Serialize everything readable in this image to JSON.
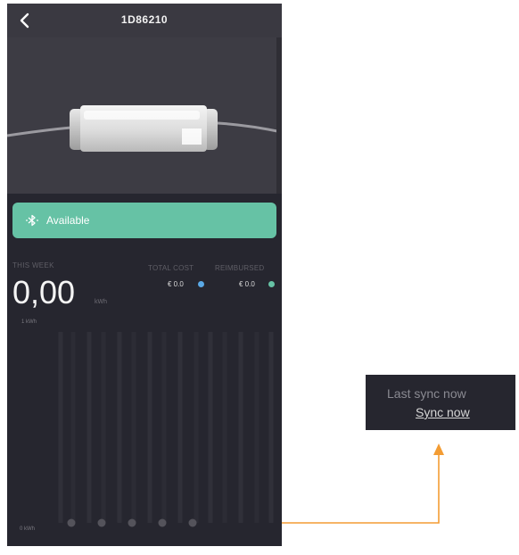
{
  "header": {
    "title": "1D86210",
    "back_icon": "chevron-left-icon"
  },
  "status": {
    "label": "Available",
    "icon": "bluetooth-icon",
    "color": "#66c2a5"
  },
  "summary": {
    "week_label": "THIS WEEK",
    "energy_value": "0,00",
    "energy_unit": "kWh",
    "total_cost_label": "TOTAL COST",
    "total_cost_value": "€ 0.0",
    "total_cost_color": "#5aa9e6",
    "reimbursed_label": "REIMBURSED",
    "reimbursed_value": "€ 0.0",
    "reimbursed_color": "#66c2a5"
  },
  "chart": {
    "axis_top_label": "1 kWh",
    "axis_bottom_label": "0 kWh"
  },
  "chart_data": {
    "type": "bar",
    "categories": [],
    "values": [
      0,
      0,
      0,
      0,
      0
    ],
    "title": "",
    "xlabel": "",
    "ylabel": "kWh",
    "ylim": [
      0,
      1
    ]
  },
  "sync": {
    "last_sync_label": "Last sync now",
    "sync_button_label": "Sync now"
  },
  "colors": {
    "background": "#26262f",
    "accent_orange": "#f39c33"
  }
}
